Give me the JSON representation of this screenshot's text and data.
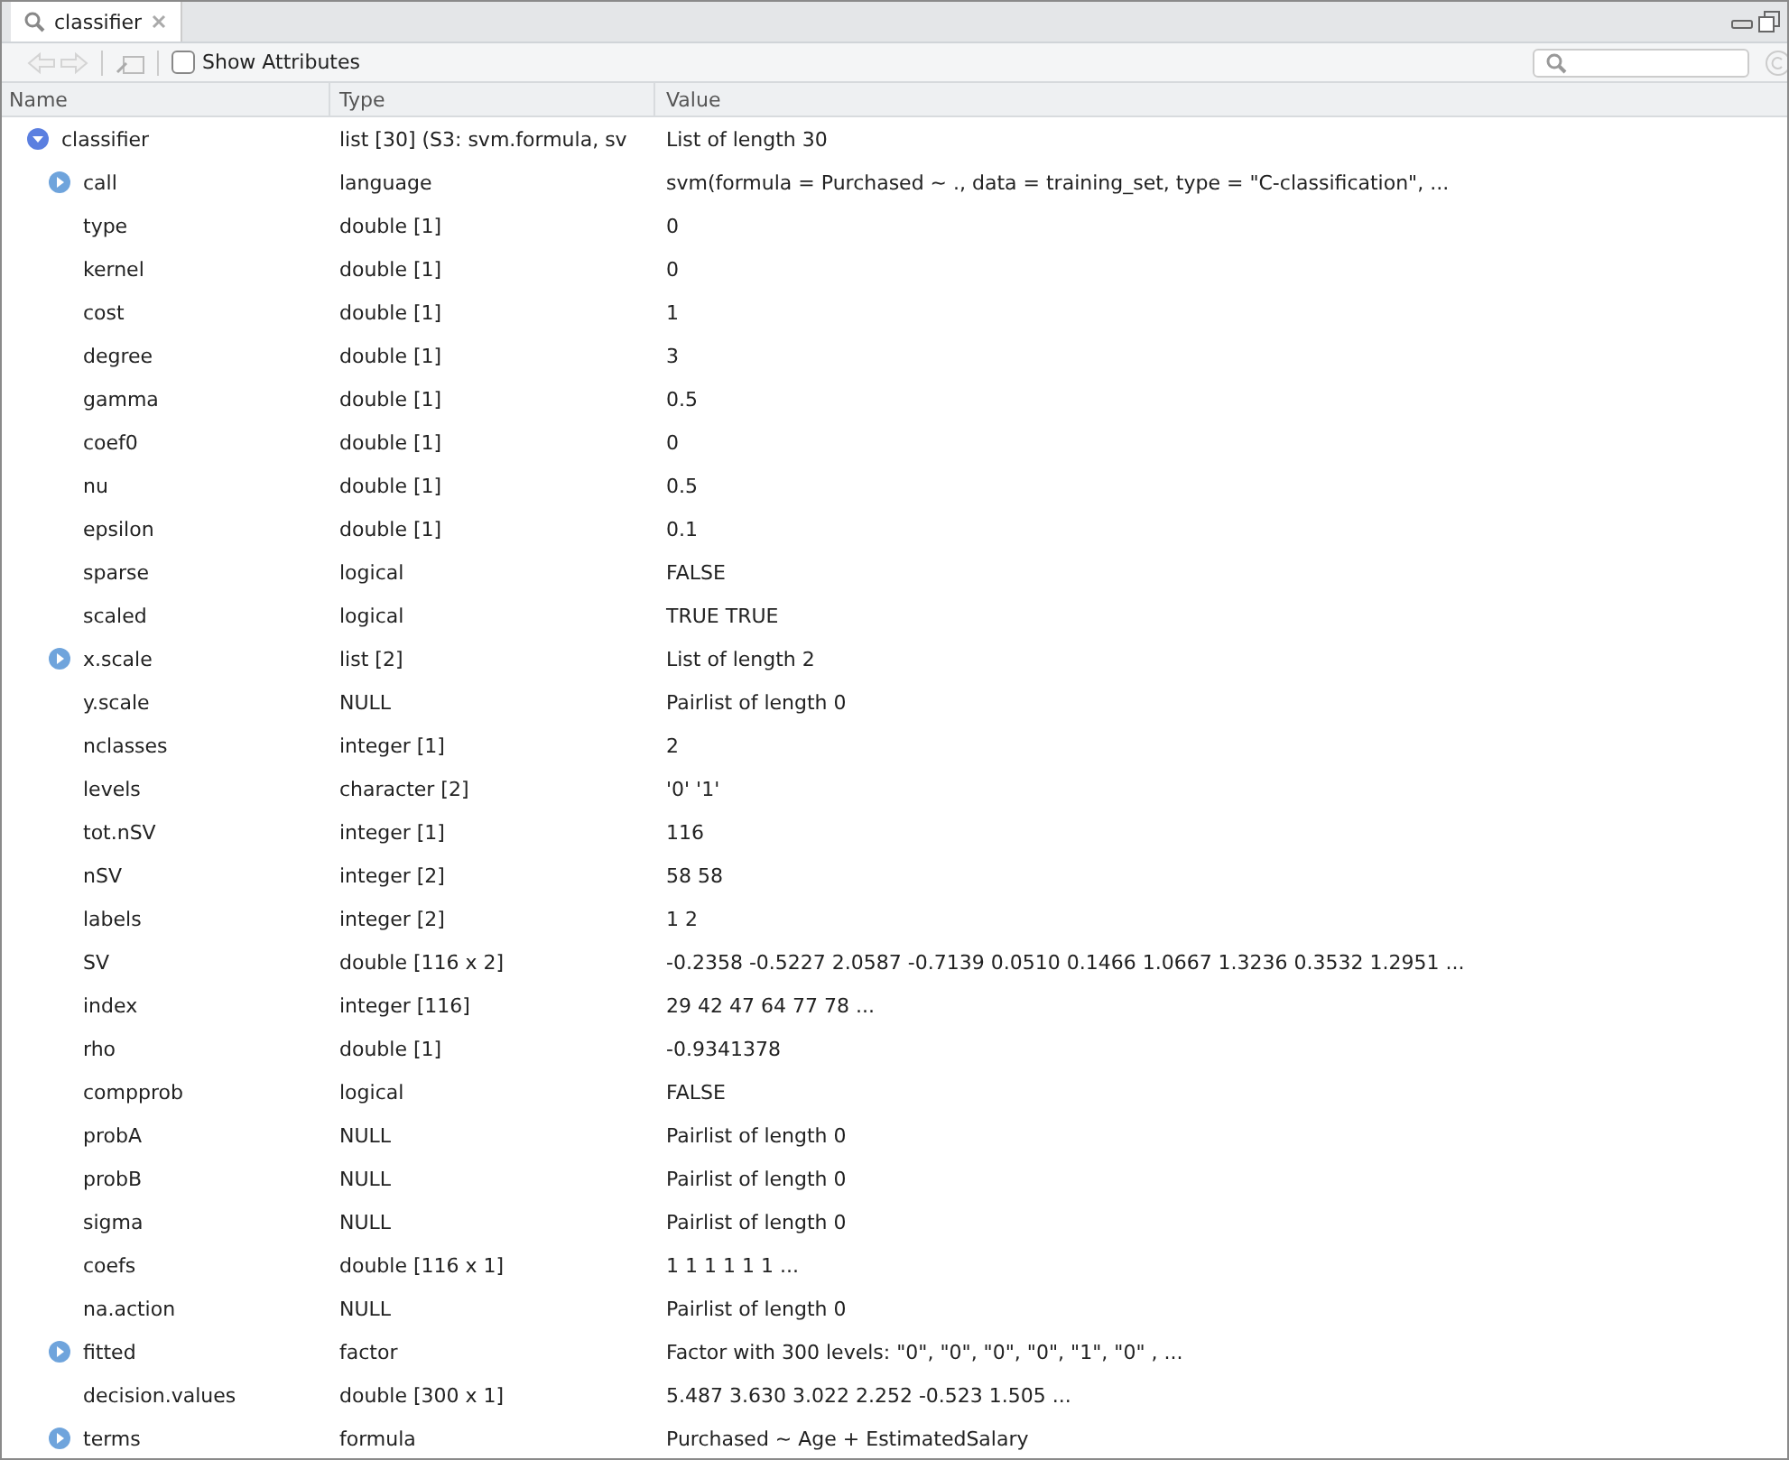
{
  "tab": {
    "title": "classifier"
  },
  "toolbar": {
    "show_attributes": {
      "label": "Show Attributes",
      "checked": false
    }
  },
  "columns": [
    "Name",
    "Type",
    "Value"
  ],
  "tree": [
    {
      "name": "classifier",
      "type": "list [30] (S3: svm.formula, sv",
      "value": "List of length 30",
      "expanded": true,
      "children": [
        {
          "name": "call",
          "type": "language",
          "value": "svm(formula = Purchased ~ ., data = training_set, type = \"C-classification\", ...",
          "expandable": true
        },
        {
          "name": "type",
          "type": "double [1]",
          "value": "0",
          "expandable": false
        },
        {
          "name": "kernel",
          "type": "double [1]",
          "value": "0",
          "expandable": false
        },
        {
          "name": "cost",
          "type": "double [1]",
          "value": "1",
          "expandable": false
        },
        {
          "name": "degree",
          "type": "double [1]",
          "value": "3",
          "expandable": false
        },
        {
          "name": "gamma",
          "type": "double [1]",
          "value": "0.5",
          "expandable": false
        },
        {
          "name": "coef0",
          "type": "double [1]",
          "value": "0",
          "expandable": false
        },
        {
          "name": "nu",
          "type": "double [1]",
          "value": "0.5",
          "expandable": false
        },
        {
          "name": "epsilon",
          "type": "double [1]",
          "value": "0.1",
          "expandable": false
        },
        {
          "name": "sparse",
          "type": "logical",
          "value": "FALSE",
          "expandable": false
        },
        {
          "name": "scaled",
          "type": "logical",
          "value": "TRUE TRUE",
          "expandable": false
        },
        {
          "name": "x.scale",
          "type": "list [2]",
          "value": "List of length 2",
          "expandable": true
        },
        {
          "name": "y.scale",
          "type": "NULL",
          "value": "Pairlist of length 0",
          "expandable": false
        },
        {
          "name": "nclasses",
          "type": "integer [1]",
          "value": "2",
          "expandable": false
        },
        {
          "name": "levels",
          "type": "character [2]",
          "value": "'0' '1'",
          "expandable": false
        },
        {
          "name": "tot.nSV",
          "type": "integer [1]",
          "value": "116",
          "expandable": false
        },
        {
          "name": "nSV",
          "type": "integer [2]",
          "value": "58 58",
          "expandable": false
        },
        {
          "name": "labels",
          "type": "integer [2]",
          "value": "1 2",
          "expandable": false
        },
        {
          "name": "SV",
          "type": "double [116 x 2]",
          "value": "-0.2358 -0.5227 2.0587 -0.7139 0.0510 0.1466 1.0667 1.3236 0.3532 1.2951 ...",
          "expandable": false
        },
        {
          "name": "index",
          "type": "integer [116]",
          "value": "29 42 47 64 77 78 ...",
          "expandable": false
        },
        {
          "name": "rho",
          "type": "double [1]",
          "value": "-0.9341378",
          "expandable": false
        },
        {
          "name": "compprob",
          "type": "logical",
          "value": "FALSE",
          "expandable": false
        },
        {
          "name": "probA",
          "type": "NULL",
          "value": "Pairlist of length 0",
          "expandable": false
        },
        {
          "name": "probB",
          "type": "NULL",
          "value": "Pairlist of length 0",
          "expandable": false
        },
        {
          "name": "sigma",
          "type": "NULL",
          "value": "Pairlist of length 0",
          "expandable": false
        },
        {
          "name": "coefs",
          "type": "double [116 x 1]",
          "value": "1 1 1 1 1 1 ...",
          "expandable": false
        },
        {
          "name": "na.action",
          "type": "NULL",
          "value": "Pairlist of length 0",
          "expandable": false
        },
        {
          "name": "fitted",
          "type": "factor",
          "value": "Factor with 300 levels: \"0\", \"0\", \"0\", \"0\", \"1\", \"0\" , ...",
          "expandable": true
        },
        {
          "name": "decision.values",
          "type": "double [300 x 1]",
          "value": "5.487 3.630 3.022 2.252 -0.523 1.505 ...",
          "expandable": false
        },
        {
          "name": "terms",
          "type": "formula",
          "value": "Purchased ~ Age + EstimatedSalary",
          "expandable": true
        }
      ]
    }
  ]
}
